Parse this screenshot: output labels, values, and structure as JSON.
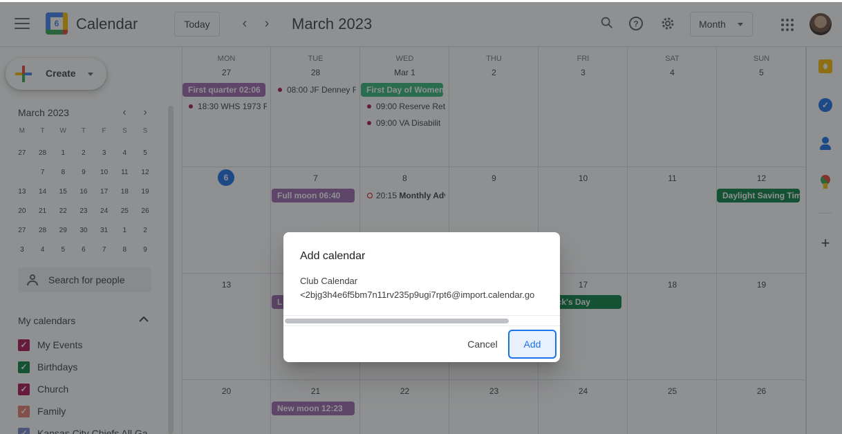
{
  "header": {
    "app_name": "Calendar",
    "logo_digit": "6",
    "today_label": "Today",
    "month_title": "March 2023",
    "view_label": "Month",
    "icons": [
      "menu-icon",
      "search-icon",
      "help-icon",
      "settings-icon",
      "apps-icon"
    ]
  },
  "sidebar": {
    "create_label": "Create",
    "mini": {
      "title": "March 2023",
      "weekdays": [
        "M",
        "T",
        "W",
        "T",
        "F",
        "S",
        "S"
      ],
      "weeks": [
        [
          "27",
          "28",
          "1",
          "2",
          "3",
          "4",
          "5"
        ],
        [
          "6",
          "7",
          "8",
          "9",
          "10",
          "11",
          "12"
        ],
        [
          "13",
          "14",
          "15",
          "16",
          "17",
          "18",
          "19"
        ],
        [
          "20",
          "21",
          "22",
          "23",
          "24",
          "25",
          "26"
        ],
        [
          "27",
          "28",
          "29",
          "30",
          "31",
          "1",
          "2"
        ],
        [
          "3",
          "4",
          "5",
          "6",
          "7",
          "8",
          "9"
        ]
      ]
    },
    "people_placeholder": "Search for people",
    "my_calendars_title": "My calendars",
    "calendars": [
      {
        "label": "My Events",
        "color": "#ad1457"
      },
      {
        "label": "Birthdays",
        "color": "#0b8043"
      },
      {
        "label": "Church",
        "color": "#ad1457"
      },
      {
        "label": "Family",
        "color": "#e67c73"
      },
      {
        "label": "Kansas City Chiefs All Ga",
        "color": "#7986cb"
      }
    ]
  },
  "grid": {
    "weekdays": [
      "MON",
      "TUE",
      "WED",
      "THU",
      "FRI",
      "SAT",
      "SUN"
    ],
    "weeks": [
      [
        "27",
        "28",
        "Mar 1",
        "2",
        "3",
        "4",
        "5"
      ],
      [
        "6",
        "7",
        "8",
        "9",
        "10",
        "11",
        "12"
      ],
      [
        "13",
        "14",
        "15",
        "16",
        "17",
        "18",
        "19"
      ],
      [
        "20",
        "21",
        "22",
        "23",
        "24",
        "25",
        "26"
      ]
    ],
    "events": {
      "first_quarter": "First quarter 02:06",
      "whs": "18:30 WHS 1973 R",
      "jf_denney": "08:00 JF Denney F",
      "first_day_women": "First Day of Women",
      "reserve": "09:00 Reserve Ret",
      "va_disability": "09:00 VA Disabilit",
      "full_moon": "Full moon 06:40",
      "monthly_time": "20:15",
      "monthly_title": "Monthly Adv",
      "daylight": "Daylight Saving Tim",
      "l_chip": "L",
      "patricks": "atrick's Day",
      "new_moon": "New moon 12:23"
    },
    "colors": {
      "moon": "#9e69af",
      "holiday_green": "#0b8043",
      "womens": "#33b679",
      "dot_pink": "#ad1457"
    }
  },
  "dialog": {
    "title": "Add calendar",
    "calendar_name": "Club Calendar",
    "calendar_id": "<2bjg3h4e6f5bm7n11rv235p9ugi7rpt6@import.calendar.go",
    "cancel_label": "Cancel",
    "add_label": "Add"
  }
}
